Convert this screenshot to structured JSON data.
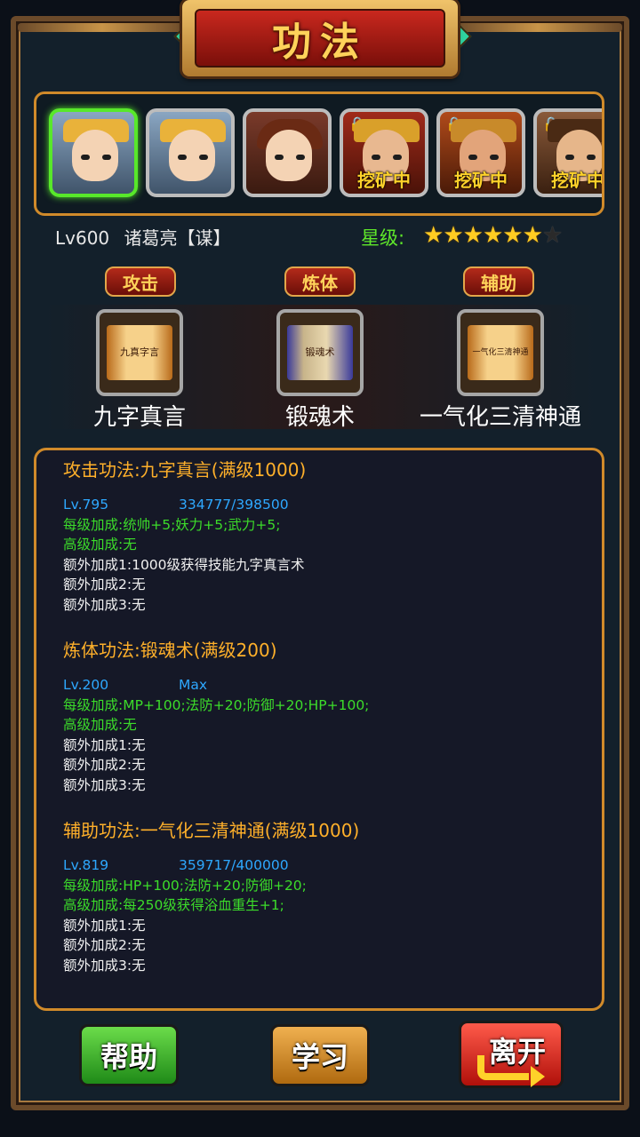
{
  "title": "功法",
  "heroes": [
    {
      "name": "hero-zhuge-1",
      "selected": true,
      "status": "",
      "locked": false
    },
    {
      "name": "hero-zhuge-2",
      "selected": false,
      "status": "",
      "locked": false
    },
    {
      "name": "hero-girl",
      "selected": false,
      "status": "",
      "locked": false
    },
    {
      "name": "hero-general-1",
      "selected": false,
      "status": "挖矿中",
      "locked": true
    },
    {
      "name": "hero-general-2",
      "selected": false,
      "status": "挖矿中",
      "locked": true
    },
    {
      "name": "hero-general-3",
      "selected": false,
      "status": "挖矿中",
      "locked": true
    }
  ],
  "hero_info": {
    "level": "Lv600",
    "name": "诸葛亮【谋】",
    "star_label": "星级:",
    "stars_filled": 6,
    "stars_total": 7
  },
  "tabs": [
    {
      "label": "攻击",
      "gongfa": "九字真言",
      "scroll_text": "九真字言"
    },
    {
      "label": "炼体",
      "gongfa": "锻魂术",
      "scroll_text": "锻魂术"
    },
    {
      "label": "辅助",
      "gongfa": "一气化三清神通",
      "scroll_text": "一气化三清神通"
    }
  ],
  "details": [
    {
      "title": "攻击功法:九字真言(满级1000)",
      "level": "Lv.795",
      "progress": "334777/398500",
      "per_level": "每级加成:统帅+5;妖力+5;武力+5;",
      "high_level": "高级加成:无",
      "extra1": "额外加成1:1000级获得技能九字真言术",
      "extra2": "额外加成2:无",
      "extra3": "额外加成3:无"
    },
    {
      "title": "炼体功法:锻魂术(满级200)",
      "level": "Lv.200",
      "progress": "Max",
      "per_level": "每级加成:MP+100;法防+20;防御+20;HP+100;",
      "high_level": "高级加成:无",
      "extra1": "额外加成1:无",
      "extra2": "额外加成2:无",
      "extra3": "额外加成3:无"
    },
    {
      "title": "辅助功法:一气化三清神通(满级1000)",
      "level": "Lv.819",
      "progress": "359717/400000",
      "per_level": "每级加成:HP+100;法防+20;防御+20;",
      "high_level": "高级加成:每250级获得浴血重生+1;",
      "extra1": "额外加成1:无",
      "extra2": "额外加成2:无",
      "extra3": "额外加成3:无"
    }
  ],
  "buttons": {
    "help": "帮助",
    "learn": "学习",
    "leave": "离开"
  },
  "colors": {
    "accent_orange": "#d08a2a",
    "title_gold": "#ffb02a",
    "level_blue": "#2ea8ff",
    "bonus_green": "#3cdc2a",
    "selected_green": "#58e82a"
  }
}
